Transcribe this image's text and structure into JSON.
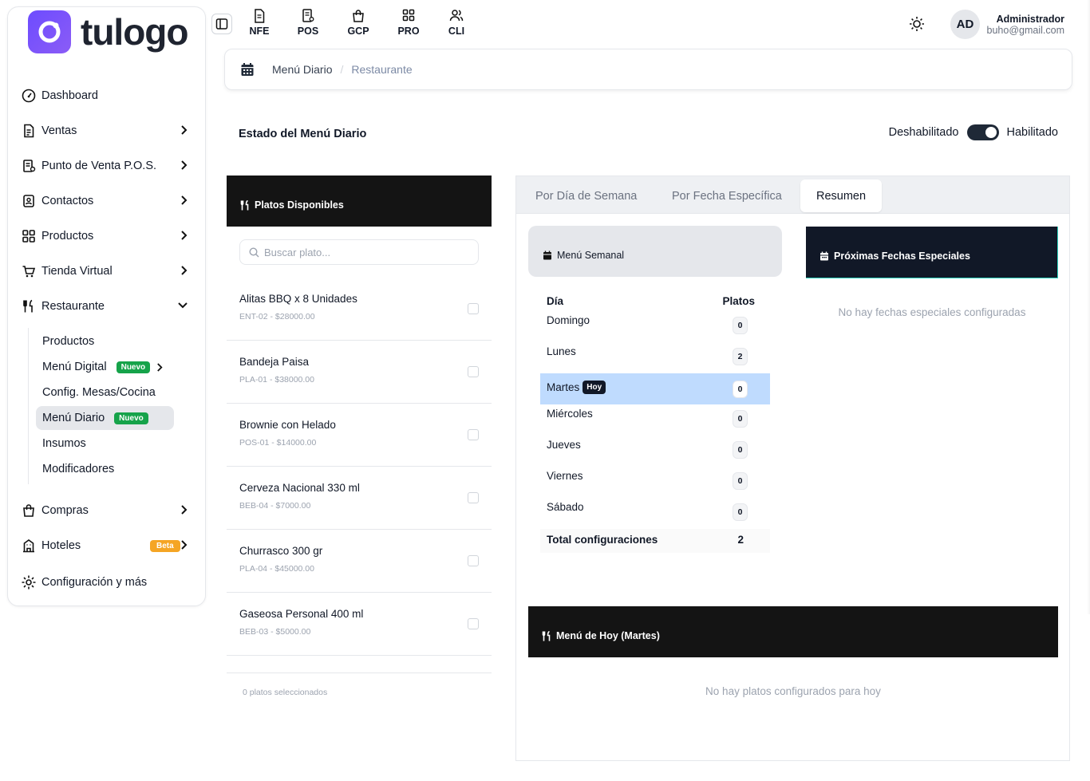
{
  "app": {
    "logo_text": "tulogo",
    "brand_color": "#6d4cff"
  },
  "sidebar": {
    "items": [
      {
        "label": "Dashboard",
        "icon": "gauge-icon"
      },
      {
        "label": "Ventas",
        "icon": "file-text-icon"
      },
      {
        "label": "Punto de Venta P.O.S.",
        "icon": "receipt-icon"
      },
      {
        "label": "Contactos",
        "icon": "contacts-icon"
      },
      {
        "label": "Productos",
        "icon": "grid-icon"
      },
      {
        "label": "Tienda Virtual",
        "icon": "cart-icon"
      },
      {
        "label": "Restaurante",
        "icon": "utensils-icon"
      },
      {
        "label": "Compras",
        "icon": "shopping-bag-icon"
      },
      {
        "label": "Hoteles",
        "icon": "building-icon",
        "badge": "Beta"
      },
      {
        "label": "Configuración y más",
        "icon": "gear-icon"
      }
    ],
    "restaurante_sub": [
      {
        "label": "Productos"
      },
      {
        "label": "Menú Digital",
        "badge": "Nuevo"
      },
      {
        "label": "Config. Mesas/Cocina"
      },
      {
        "label": "Menú Diario",
        "badge": "Nuevo",
        "active": true
      },
      {
        "label": "Insumos"
      },
      {
        "label": "Modificadores"
      }
    ]
  },
  "topbar": {
    "modules": [
      "NFE",
      "POS",
      "GCP",
      "PRO",
      "CLI"
    ],
    "user_initials": "AD",
    "user_name": "Administrador",
    "user_email": "buho@gmail.com"
  },
  "breadcrumb": {
    "current": "Menú Diario",
    "parent": "Restaurante"
  },
  "status": {
    "title": "Estado del Menú Diario",
    "off_label": "Deshabilitado",
    "on_label": "Habilitado",
    "enabled": true
  },
  "dishes": {
    "title": "Platos Disponibles",
    "search_placeholder": "Buscar plato...",
    "items": [
      {
        "name": "Alitas BBQ x 8 Unidades",
        "meta": "ENT-02 - $28000.00"
      },
      {
        "name": "Bandeja Paisa",
        "meta": "PLA-01 - $38000.00"
      },
      {
        "name": "Brownie con Helado",
        "meta": "POS-01 - $14000.00"
      },
      {
        "name": "Cerveza Nacional 330 ml",
        "meta": "BEB-04 - $7000.00"
      },
      {
        "name": "Churrasco 300 gr",
        "meta": "PLA-04 - $45000.00"
      },
      {
        "name": "Gaseosa Personal 400 ml",
        "meta": "BEB-03 - $5000.00"
      }
    ],
    "footer": "0 platos seleccionados"
  },
  "tabs": [
    {
      "label": "Por Día de Semana"
    },
    {
      "label": "Por Fecha Específica"
    },
    {
      "label": "Resumen",
      "active": true
    }
  ],
  "weekly": {
    "title": "Menú Semanal",
    "col_day": "Día",
    "col_dishes": "Platos",
    "rows": [
      {
        "day": "Domingo",
        "count": "0"
      },
      {
        "day": "Lunes",
        "count": "2"
      },
      {
        "day": "Martes",
        "count": "0",
        "today": true
      },
      {
        "day": "Miércoles",
        "count": "0"
      },
      {
        "day": "Jueves",
        "count": "0"
      },
      {
        "day": "Viernes",
        "count": "0"
      },
      {
        "day": "Sábado",
        "count": "0"
      }
    ],
    "today_badge": "Hoy",
    "total_label": "Total configuraciones",
    "total_value": "2"
  },
  "special": {
    "title": "Próximas Fechas Especiales",
    "empty": "No hay fechas especiales configuradas"
  },
  "today_menu": {
    "title": "Menú de Hoy (Martes)",
    "empty": "No hay platos configurados para hoy"
  }
}
